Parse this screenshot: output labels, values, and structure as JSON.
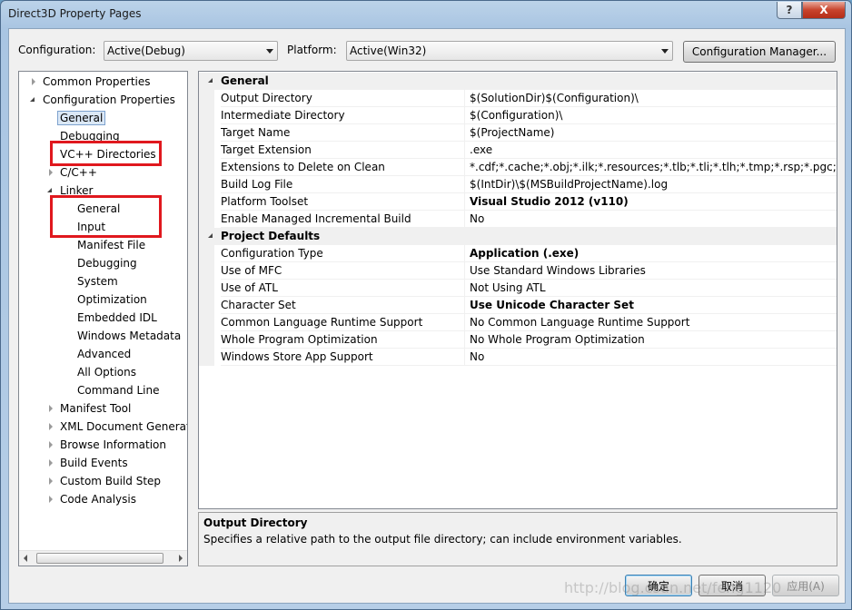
{
  "window": {
    "title": "Direct3D Property Pages",
    "help_glyph": "?",
    "close_glyph": "X"
  },
  "toolbar": {
    "configuration_label": "Configuration:",
    "configuration_value": "Active(Debug)",
    "platform_label": "Platform:",
    "platform_value": "Active(Win32)",
    "config_manager_label": "Configuration Manager..."
  },
  "tree": {
    "items": [
      {
        "label": "Common Properties"
      },
      {
        "label": "Configuration Properties"
      },
      {
        "label": "General"
      },
      {
        "label": "Debugging"
      },
      {
        "label": "VC++ Directories"
      },
      {
        "label": "C/C++"
      },
      {
        "label": "Linker"
      },
      {
        "label": "General"
      },
      {
        "label": "Input"
      },
      {
        "label": "Manifest File"
      },
      {
        "label": "Debugging"
      },
      {
        "label": "System"
      },
      {
        "label": "Optimization"
      },
      {
        "label": "Embedded IDL"
      },
      {
        "label": "Windows Metadata"
      },
      {
        "label": "Advanced"
      },
      {
        "label": "All Options"
      },
      {
        "label": "Command Line"
      },
      {
        "label": "Manifest Tool"
      },
      {
        "label": "XML Document Generat"
      },
      {
        "label": "Browse Information"
      },
      {
        "label": "Build Events"
      },
      {
        "label": "Custom Build Step"
      },
      {
        "label": "Code Analysis"
      }
    ]
  },
  "grid": {
    "categories": [
      {
        "label": "General"
      },
      {
        "label": "Project Defaults"
      }
    ],
    "rows": [
      {
        "name": "Output Directory",
        "value": "$(SolutionDir)$(Configuration)\\"
      },
      {
        "name": "Intermediate Directory",
        "value": "$(Configuration)\\"
      },
      {
        "name": "Target Name",
        "value": "$(ProjectName)"
      },
      {
        "name": "Target Extension",
        "value": ".exe"
      },
      {
        "name": "Extensions to Delete on Clean",
        "value": "*.cdf;*.cache;*.obj;*.ilk;*.resources;*.tlb;*.tli;*.tlh;*.tmp;*.rsp;*.pgc;*.pgd;*"
      },
      {
        "name": "Build Log File",
        "value": "$(IntDir)\\$(MSBuildProjectName).log"
      },
      {
        "name": "Platform Toolset",
        "value": "Visual Studio 2012 (v110)"
      },
      {
        "name": "Enable Managed Incremental Build",
        "value": "No"
      },
      {
        "name": "Configuration Type",
        "value": "Application (.exe)"
      },
      {
        "name": "Use of MFC",
        "value": "Use Standard Windows Libraries"
      },
      {
        "name": "Use of ATL",
        "value": "Not Using ATL"
      },
      {
        "name": "Character Set",
        "value": "Use Unicode Character Set"
      },
      {
        "name": "Common Language Runtime Support",
        "value": "No Common Language Runtime Support"
      },
      {
        "name": "Whole Program Optimization",
        "value": "No Whole Program Optimization"
      },
      {
        "name": "Windows Store App Support",
        "value": "No"
      }
    ]
  },
  "description": {
    "title": "Output Directory",
    "text": "Specifies a relative path to the output file directory; can include environment variables."
  },
  "buttons": {
    "ok": "确定",
    "cancel": "取消",
    "apply": "应用(A)"
  },
  "watermark": "http://blog.csdn.net/feng1120"
}
